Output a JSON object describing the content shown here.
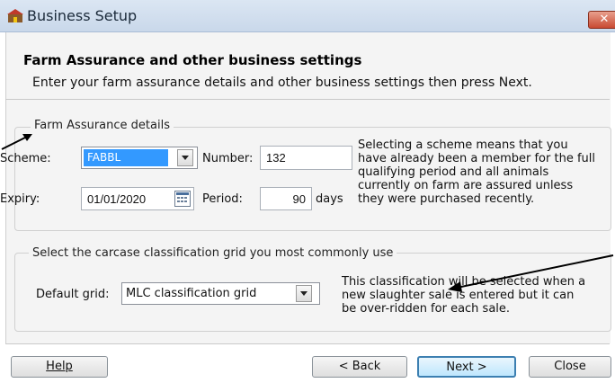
{
  "window": {
    "title": "Business Setup",
    "close_label": "✕",
    "icon": "farm-app-icon"
  },
  "header": {
    "title": "Farm Assurance and other business settings",
    "subtitle": "Enter your farm assurance details and other business settings then press Next."
  },
  "farm_assurance": {
    "group_title": "Farm Assurance details",
    "scheme_label": "Scheme:",
    "scheme_value": "FABBL",
    "number_label": "Number:",
    "number_value": "132",
    "expiry_label": "Expiry:",
    "expiry_value": "01/01/2020",
    "period_label": "Period:",
    "period_value": "90",
    "period_unit": "days",
    "note_lines": [
      "Selecting a scheme means that you",
      "have already been a member for the full",
      "qualifying period and all animals",
      "currently on farm are assured unless",
      "they were purchased recently."
    ]
  },
  "classification": {
    "group_title": "Select the carcase classification grid you most commonly use",
    "default_grid_label": "Default grid:",
    "default_grid_value": "MLC classification grid",
    "note_lines": [
      "This classification will be selected when a",
      "new slaughter sale is entered but it can",
      "be over-ridden for each sale."
    ]
  },
  "footer": {
    "help_label": "Help",
    "back_label": "< Back",
    "next_label": "Next >",
    "close_label": "Close"
  },
  "colors": {
    "selection": "#3399ff",
    "default_button_border": "#3c7fb1",
    "title_gradient": "#c9d8ea"
  }
}
